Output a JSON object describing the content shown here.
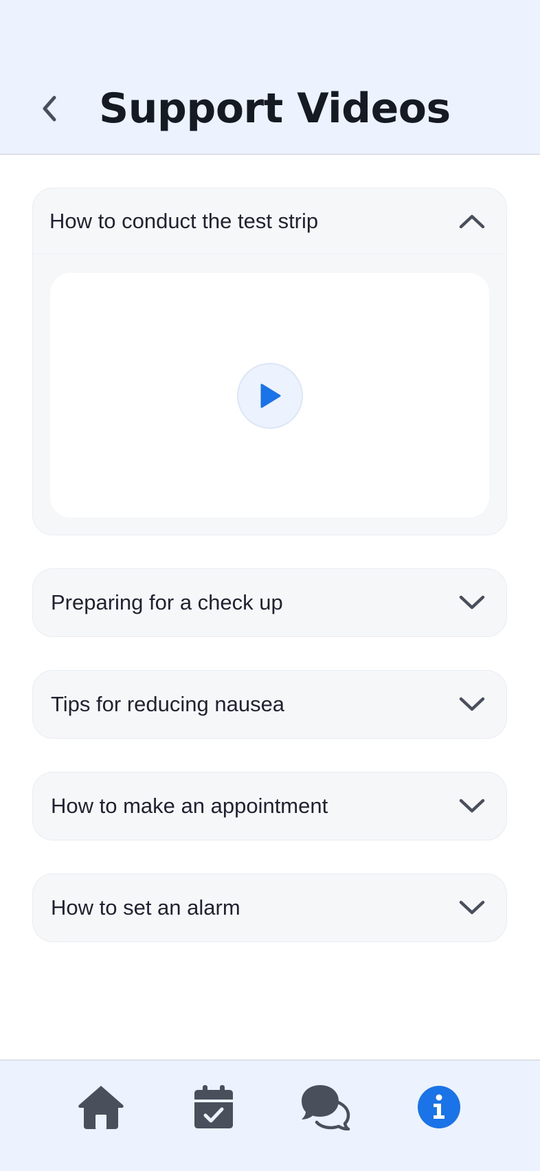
{
  "header": {
    "title": "Support Videos",
    "back_icon": "chevron-left-icon"
  },
  "videos": [
    {
      "title": "How to conduct the test strip",
      "expanded": true
    },
    {
      "title": "Preparing for a check up",
      "expanded": false
    },
    {
      "title": "Tips for reducing nausea",
      "expanded": false
    },
    {
      "title": "How to make an appointment",
      "expanded": false
    },
    {
      "title": "How to set an alarm",
      "expanded": false
    }
  ],
  "player": {
    "icon": "play-icon"
  },
  "bottom_nav": {
    "items": [
      {
        "icon": "home-icon",
        "active": false
      },
      {
        "icon": "calendar-check-icon",
        "active": false
      },
      {
        "icon": "chat-bubbles-icon",
        "active": false
      },
      {
        "icon": "info-icon",
        "active": true
      }
    ]
  },
  "colors": {
    "header_bg": "#edf3fe",
    "card_bg": "#f6f7f9",
    "accent": "#1b73e8",
    "icon_gray": "#4a4f5c",
    "title_text": "#161a22"
  }
}
